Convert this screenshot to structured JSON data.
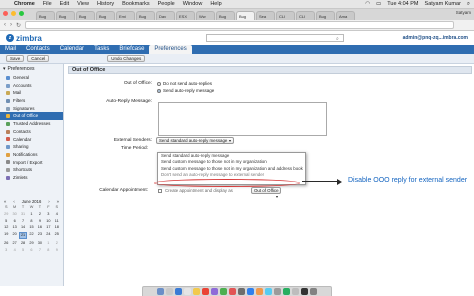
{
  "mac_menu": {
    "apple": "",
    "items": [
      "Chrome",
      "File",
      "Edit",
      "View",
      "History",
      "Bookmarks",
      "People",
      "Window",
      "Help"
    ],
    "time": "Tue 4:04 PM",
    "user": "Satyam Kumar"
  },
  "browser_tabs": [
    "Bug",
    "Bug",
    "Bug",
    "Bug",
    "Emi",
    "Bug",
    "Dav",
    "ESX",
    "Ww",
    "Bug",
    "Bug",
    "Sea",
    "CLI",
    "CLI",
    "Bug",
    "Ama"
  ],
  "browser_user": "Satyam",
  "url_text": "",
  "zimbra": {
    "logo": "zimbra",
    "search_placeholder": "",
    "user": "admin@pnq-zq...imbra.com"
  },
  "nav": [
    "Mail",
    "Contacts",
    "Calendar",
    "Tasks",
    "Briefcase",
    "Preferences"
  ],
  "toolbar": {
    "save": "Save",
    "cancel": "Cancel",
    "undo": "Undo Changes"
  },
  "sidebar": {
    "heading": "Preferences",
    "items": [
      "General",
      "Accounts",
      "Mail",
      "Filters",
      "Signatures",
      "Out of Office",
      "Trusted Addresses",
      "Contacts",
      "Calendar",
      "Sharing",
      "Notifications",
      "Import / Export",
      "Shortcuts",
      "Zimlets"
    ],
    "selected": "Out of Office"
  },
  "calendar": {
    "month": "June 2016",
    "days": [
      "S",
      "M",
      "T",
      "W",
      "T",
      "F",
      "S"
    ],
    "weeks": [
      [
        "29",
        "30",
        "31",
        "1",
        "2",
        "3",
        "4"
      ],
      [
        "5",
        "6",
        "7",
        "8",
        "9",
        "10",
        "11"
      ],
      [
        "12",
        "13",
        "14",
        "15",
        "16",
        "17",
        "18"
      ],
      [
        "19",
        "20",
        "21",
        "22",
        "23",
        "24",
        "25"
      ],
      [
        "26",
        "27",
        "28",
        "29",
        "30",
        "1",
        "2"
      ],
      [
        "3",
        "4",
        "5",
        "6",
        "7",
        "8",
        "9"
      ]
    ],
    "today": "21"
  },
  "ooo": {
    "section_title": "Out of Office",
    "label_ooo": "Out of Office:",
    "opt_no": "Do not send auto-replies",
    "opt_yes": "Send auto-reply message",
    "label_msg": "Auto-Reply Message:",
    "label_external": "External Senders:",
    "external_selected": "Send standard auto-reply message",
    "label_time": "Time Period:",
    "dropdown_options": [
      "Send standard auto-reply message",
      "Send custom message to those not in my organization",
      "Send custom message to those not in my organization and address book",
      "Don't send an auto-reply message to external sender"
    ],
    "label_cal": "Calendar Appointment:",
    "cal_text": "Create appointment and display as",
    "cal_select": "Out of Office"
  },
  "annotation": "Disable OOO reply for external sender",
  "colors": {
    "nav_blue": "#2f6db1",
    "annotation_blue": "#1565c0",
    "oval_red": "#d63a3a"
  }
}
